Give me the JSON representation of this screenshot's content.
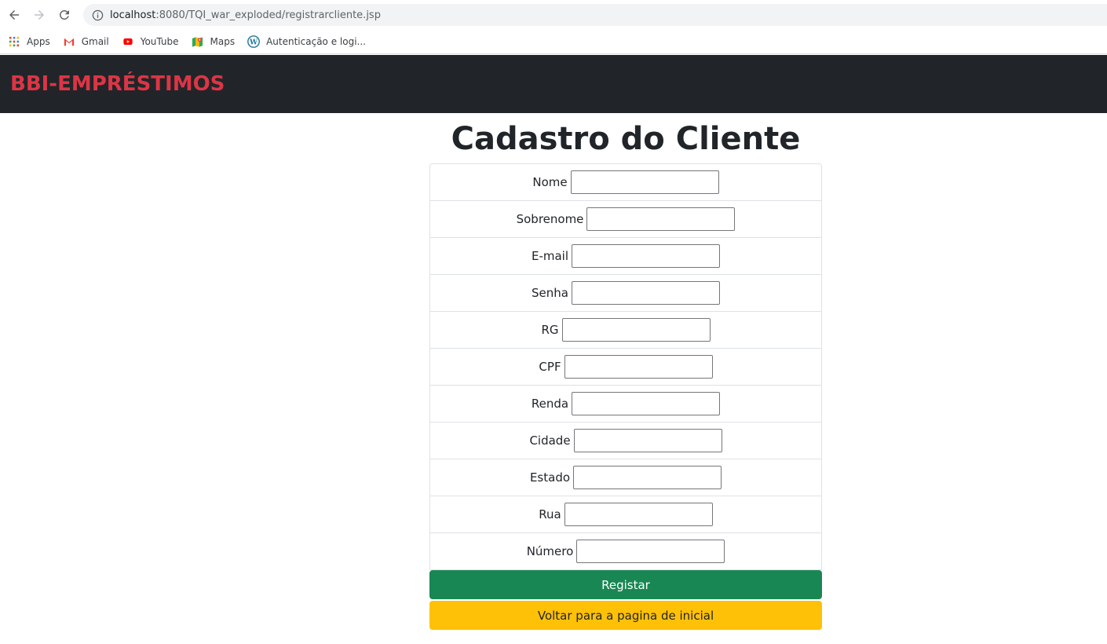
{
  "browser": {
    "url_host": "localhost",
    "url_path": ":8080/TQI_war_exploded/registrarcliente.jsp",
    "bookmarks": [
      {
        "label": "Apps",
        "icon": "apps-grid-icon"
      },
      {
        "label": "Gmail",
        "icon": "gmail-icon"
      },
      {
        "label": "YouTube",
        "icon": "youtube-icon"
      },
      {
        "label": "Maps",
        "icon": "maps-icon"
      },
      {
        "label": "Autenticação e logi...",
        "icon": "wordpress-icon"
      }
    ]
  },
  "navbar": {
    "brand": "BBI-EMPRÉSTIMOS",
    "brand_color": "#dc3545",
    "background": "#212529"
  },
  "main": {
    "title": "Cadastro do Cliente",
    "fields": [
      {
        "label": "Nome",
        "value": "",
        "name": "nome"
      },
      {
        "label": "Sobrenome",
        "value": "",
        "name": "sobrenome"
      },
      {
        "label": "E-mail",
        "value": "",
        "name": "email"
      },
      {
        "label": "Senha",
        "value": "",
        "name": "senha"
      },
      {
        "label": "RG",
        "value": "",
        "name": "rg"
      },
      {
        "label": "CPF",
        "value": "",
        "name": "cpf"
      },
      {
        "label": "Renda",
        "value": "",
        "name": "renda"
      },
      {
        "label": "Cidade",
        "value": "",
        "name": "cidade"
      },
      {
        "label": "Estado",
        "value": "",
        "name": "estado"
      },
      {
        "label": "Rua",
        "value": "",
        "name": "rua"
      },
      {
        "label": "Número",
        "value": "",
        "name": "numero"
      }
    ],
    "submit_label": "Registar",
    "back_label": "Voltar para a pagina de inicial",
    "colors": {
      "success": "#198754",
      "warning": "#ffc107"
    }
  }
}
